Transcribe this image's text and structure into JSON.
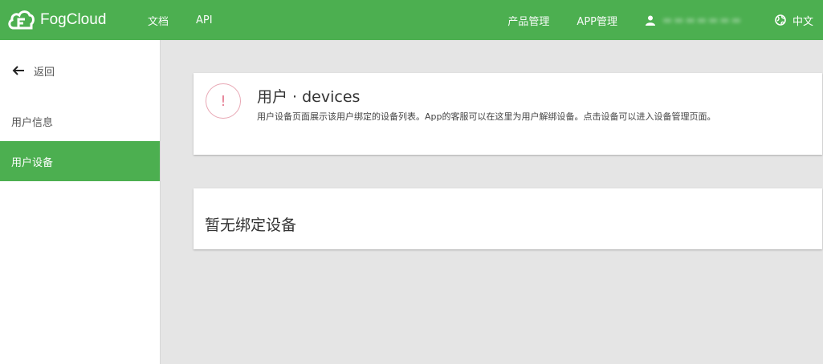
{
  "header": {
    "brand": "FogCloud",
    "nav_left": [
      "文档",
      "API"
    ],
    "nav_right": [
      "产品管理",
      "APP管理"
    ],
    "user_name": "▬▬▬▬▬▬▬",
    "language": "中文"
  },
  "sidebar": {
    "back_label": "返回",
    "items": [
      {
        "label": "用户信息"
      },
      {
        "label": "用户设备"
      }
    ]
  },
  "info_card": {
    "title": "用户 · devices",
    "alert_symbol": "!",
    "description": "用户设备页面展示该用户绑定的设备列表。App的客服可以在这里为用户解绑设备。点击设备可以进入设备管理页面。"
  },
  "empty_card": {
    "message": "暂无绑定设备"
  },
  "colors": {
    "primary": "#4caf50",
    "background": "#e5e5e5",
    "alert_pink": "#e57c91"
  },
  "icons": {
    "brand": "fogcloud-logo-icon",
    "user": "user-icon",
    "language": "globe-icon",
    "back": "arrow-left-icon",
    "alert": "exclamation-circle-icon"
  }
}
